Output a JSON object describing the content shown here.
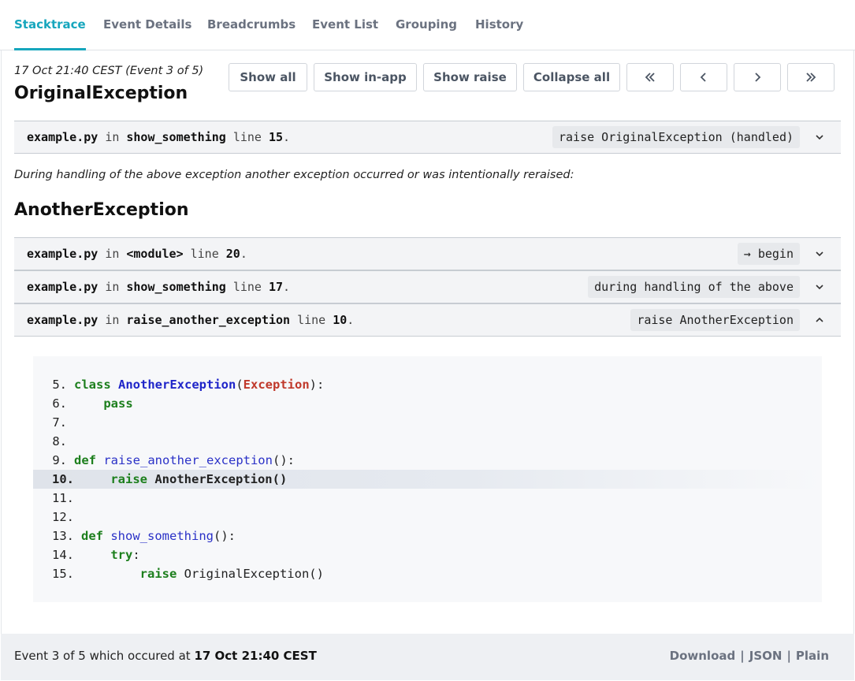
{
  "tabs": [
    {
      "label": "Stacktrace",
      "active": true
    },
    {
      "label": "Event Details"
    },
    {
      "label": "Breadcrumbs"
    },
    {
      "label": "Event List"
    },
    {
      "label": "Grouping"
    },
    {
      "label": "History"
    }
  ],
  "header": {
    "event_meta": "17 Oct 21:40 CEST (Event 3 of 5)",
    "exception_title": "OriginalException"
  },
  "buttons": {
    "show_all": "Show all",
    "show_in_app": "Show in-app",
    "show_raise": "Show raise",
    "collapse_all": "Collapse all"
  },
  "frames_original": [
    {
      "file": "example.py",
      "in": "in",
      "func": "show_something",
      "line_word": "line",
      "line": "15",
      "badge": "raise OriginalException (handled)",
      "expanded": false
    }
  ],
  "chaining_note": "During handling of the above exception another exception occurred or was intentionally reraised:",
  "second_exception_title": "AnotherException",
  "frames_another": [
    {
      "file": "example.py",
      "in": "in",
      "func": "<module>",
      "line_word": "line",
      "line": "20",
      "badge": "→ begin",
      "expanded": false
    },
    {
      "file": "example.py",
      "in": "in",
      "func": "show_something",
      "line_word": "line",
      "line": "17",
      "badge": "during handling of the above",
      "expanded": false
    },
    {
      "file": "example.py",
      "in": "in",
      "func": "raise_another_exception",
      "line_word": "line",
      "line": "10",
      "badge": "raise AnotherException",
      "expanded": true
    }
  ],
  "code": {
    "highlight_line": "10.",
    "lines": [
      {
        "num": "5.",
        "tokens": [
          [
            "k-green",
            "class"
          ],
          [
            "k-plain",
            " "
          ],
          [
            "k-blue",
            "AnotherException"
          ],
          [
            "k-plain",
            "("
          ],
          [
            "k-red",
            "Exception"
          ],
          [
            "k-plain",
            "):"
          ]
        ]
      },
      {
        "num": "6.",
        "tokens": [
          [
            "k-plain",
            "    "
          ],
          [
            "k-green",
            "pass"
          ]
        ]
      },
      {
        "num": "7.",
        "tokens": []
      },
      {
        "num": "8.",
        "tokens": []
      },
      {
        "num": "9.",
        "tokens": [
          [
            "k-green",
            "def"
          ],
          [
            "k-plain",
            " "
          ],
          [
            "k-func",
            "raise_another_exception"
          ],
          [
            "k-plain",
            "():"
          ]
        ]
      },
      {
        "num": "10.",
        "tokens": [
          [
            "k-plain",
            "    "
          ],
          [
            "k-green",
            "raise"
          ],
          [
            "k-plain",
            " AnotherException()"
          ]
        ]
      },
      {
        "num": "11.",
        "tokens": []
      },
      {
        "num": "12.",
        "tokens": []
      },
      {
        "num": "13.",
        "tokens": [
          [
            "k-green",
            "def"
          ],
          [
            "k-plain",
            " "
          ],
          [
            "k-func",
            "show_something"
          ],
          [
            "k-plain",
            "():"
          ]
        ]
      },
      {
        "num": "14.",
        "tokens": [
          [
            "k-plain",
            "    "
          ],
          [
            "k-green",
            "try"
          ],
          [
            "k-plain",
            ":"
          ]
        ]
      },
      {
        "num": "15.",
        "tokens": [
          [
            "k-plain",
            "        "
          ],
          [
            "k-green",
            "raise"
          ],
          [
            "k-plain",
            " OriginalException()"
          ]
        ]
      }
    ]
  },
  "footer": {
    "prefix": "Event 3 of 5 which occured at ",
    "timestamp": "17 Oct 21:40 CEST",
    "download": "Download",
    "json": "JSON",
    "plain": "Plain",
    "separator": "|"
  },
  "colors": {
    "accent": "#16a6bd",
    "keyword": "#1d7f1d",
    "classname": "#1f25c9",
    "builtin": "#c0392b"
  }
}
